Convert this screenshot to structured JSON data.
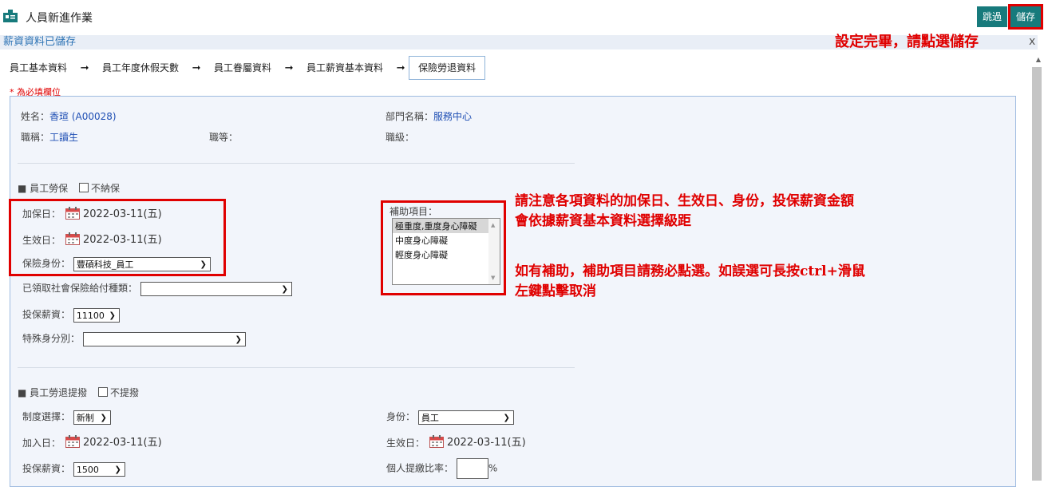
{
  "header": {
    "title": "人員新進作業",
    "skip_label": "跳過",
    "save_label": "儲存",
    "notice": "薪資資料已儲存",
    "close": "x"
  },
  "annotations": {
    "save_hint": "設定完畢，請點選儲存",
    "insurance_hint_line1": "請注意各項資料的加保日、生效日、身份，投保薪資金額",
    "insurance_hint_line2": "會依據薪資基本資料選擇級距",
    "subsidy_hint_line1": "如有補助，補助項目請務必點選。如誤選可長按ctrl+滑鼠",
    "subsidy_hint_line2": "左鍵點擊取消"
  },
  "steps": [
    {
      "label": "員工基本資料",
      "active": false
    },
    {
      "label": "員工年度休假天數",
      "active": false
    },
    {
      "label": "員工眷屬資料",
      "active": false
    },
    {
      "label": "員工薪資基本資料",
      "active": false
    },
    {
      "label": "保險勞退資料",
      "active": true
    }
  ],
  "required_note": "* 為必填欄位",
  "employee": {
    "name_label": "姓名：",
    "name_value": "香瑄 (A00028)",
    "dept_label": "部門名稱：",
    "dept_value": "服務中心",
    "title_label": "職稱：",
    "title_value": "工讀生",
    "grade_label": "職等：",
    "level_label": "職級："
  },
  "labor_insurance": {
    "section_title": "■ 員工勞保",
    "no_insure_label": "不納保",
    "add_date_label": "加保日：",
    "add_date_value": "2022-03-11(五)",
    "effective_date_label": "生效日：",
    "effective_date_value": "2022-03-11(五)",
    "identity_label": "保險身份：",
    "identity_value": "豐碩科技_員工",
    "benefit_type_label": "已領取社會保險給付種類：",
    "benefit_type_value": "",
    "salary_label": "投保薪資：",
    "salary_value": "11100",
    "special_identity_label": "特殊身分別：",
    "special_identity_value": "",
    "subsidy_label": "補助項目：",
    "subsidy_options": [
      "極重度,重度身心障礙",
      "中度身心障礙",
      "輕度身心障礙"
    ]
  },
  "pension": {
    "section_title": "■ 員工勞退提撥",
    "no_contribute_label": "不提撥",
    "system_label": "制度選擇：",
    "system_value": "新制",
    "identity_label": "身份：",
    "identity_value": "員工",
    "join_date_label": "加入日：",
    "join_date_value": "2022-03-11(五)",
    "effective_date_label": "生效日：",
    "effective_date_value": "2022-03-11(五)",
    "salary_label": "投保薪資：",
    "salary_value": "1500",
    "personal_rate_label": "個人提繳比率：",
    "personal_rate_unit": "%"
  },
  "colors": {
    "accent": "#177a7c",
    "highlight": "#e00000",
    "link": "#1f4fb4"
  }
}
